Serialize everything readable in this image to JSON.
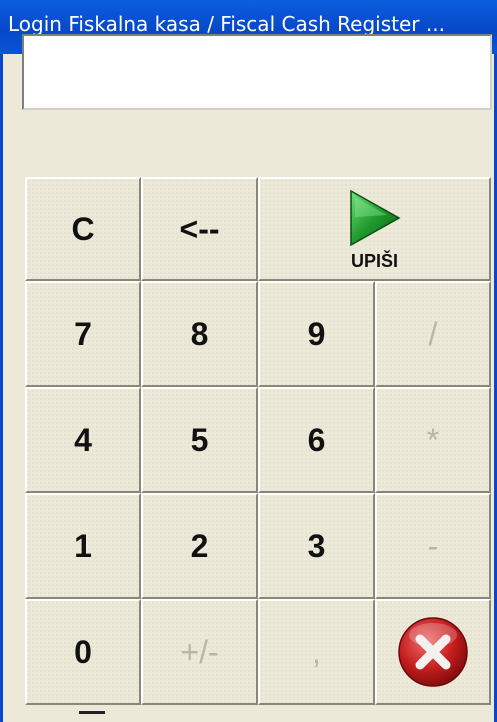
{
  "window": {
    "title": "Login Fiskalna kasa / Fiscal Cash Register ..."
  },
  "display": {
    "value": ""
  },
  "keys": {
    "clear": "C",
    "backspace": "<--",
    "enter": "UPIŠI",
    "k7": "7",
    "k8": "8",
    "k9": "9",
    "divide": "/",
    "k4": "4",
    "k5": "5",
    "k6": "6",
    "multiply": "*",
    "k1": "1",
    "k2": "2",
    "k3": "3",
    "minus": "-",
    "k0": "0",
    "plusminus": "+/-",
    "comma": ","
  },
  "icons": {
    "enter": "play-arrow-icon",
    "cancel": "close-x-icon"
  },
  "colors": {
    "titlebar": "#0848c8",
    "enter_green": "#1f9a2e",
    "cancel_red": "#c21b1b"
  }
}
